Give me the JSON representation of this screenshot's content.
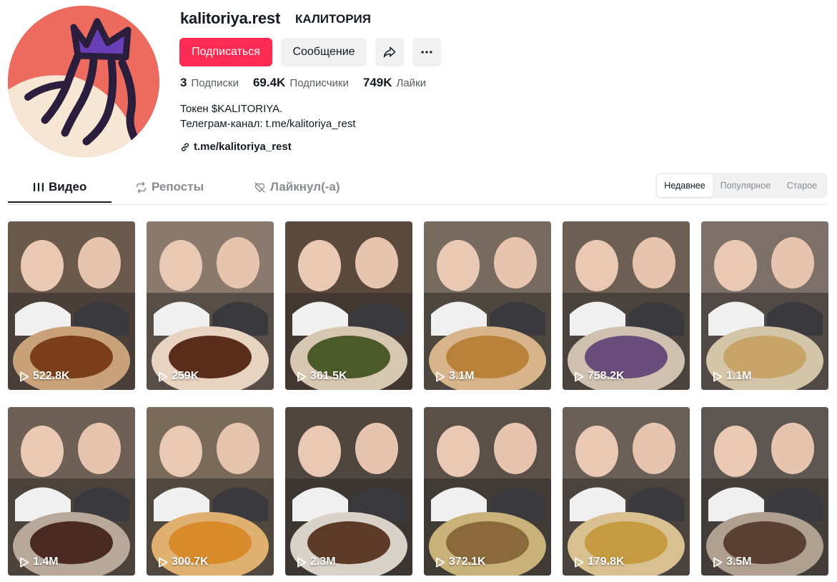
{
  "profile": {
    "username": "kalitoriya.rest",
    "nickname": "КАЛИТОРИЯ",
    "follow_label": "Подписаться",
    "message_label": "Сообщение",
    "stats": [
      {
        "value": "3",
        "label": "Подписки"
      },
      {
        "value": "69.4K",
        "label": "Подписчики"
      },
      {
        "value": "749K",
        "label": "Лайки"
      }
    ],
    "bio": [
      "Токен $KALITORIYA.",
      "Телеграм-канал: t.me/kalitoriya_rest"
    ],
    "link": "t.me/kalitoriya_rest"
  },
  "tabs": [
    {
      "label": "Видео",
      "icon": "grid-lines-icon",
      "active": true
    },
    {
      "label": "Репосты",
      "icon": "repost-icon",
      "active": false
    },
    {
      "label": "Лайкнул(-а)",
      "icon": "heart-slash-icon",
      "active": false
    }
  ],
  "sort": [
    "Недавнее",
    "Популярное",
    "Старое"
  ],
  "videos": [
    {
      "views": "522.8K"
    },
    {
      "views": "259K"
    },
    {
      "views": "361.5K"
    },
    {
      "views": "3.1M"
    },
    {
      "views": "758.2K"
    },
    {
      "views": "1.1M"
    },
    {
      "views": "1.4M"
    },
    {
      "views": "300.7K"
    },
    {
      "views": "2.3M"
    },
    {
      "views": "372.1K"
    },
    {
      "views": "179.8K"
    },
    {
      "views": "3.5M"
    }
  ],
  "colors": {
    "accent": "#FE2C55",
    "avatar_bg": "#EC6A5E",
    "avatar_cream": "#F7E6D4",
    "avatar_crown": "#6A3FB5",
    "avatar_ink": "#2A1E3C"
  }
}
